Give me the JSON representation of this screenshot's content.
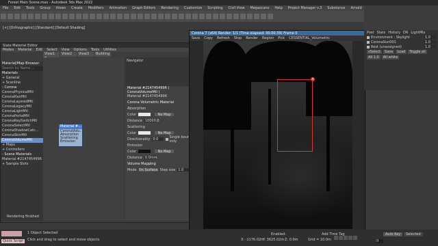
{
  "app": {
    "title": "Forest Main Scene.max - Autodesk 3ds Max 2022"
  },
  "menu": [
    "File",
    "Edit",
    "Tools",
    "Group",
    "Views",
    "Create",
    "Modifiers",
    "Animation",
    "Graph Editors",
    "Rendering",
    "Customize",
    "Scripting",
    "Civil View",
    "Megascans",
    "Help",
    "Project Manager v.3",
    "Substance",
    "Arnold",
    "Phoenix FD"
  ],
  "viewport_label": "[+] [Orthographic] [Standard] [Default Shading]",
  "material_editor": {
    "title": "Slate Material Editor",
    "menu": [
      "Modes",
      "Material",
      "Edit",
      "Select",
      "View",
      "Options",
      "Tools",
      "Utilities"
    ],
    "browser_title": "Material/Map Browser",
    "search_placeholder": "Search by Name ...",
    "tree": [
      {
        "label": "Materials",
        "kind": "header"
      },
      {
        "label": "+ General",
        "kind": "item"
      },
      {
        "label": "+ Scanline",
        "kind": "item"
      },
      {
        "label": "- Corona",
        "kind": "header"
      },
      {
        "label": "CoronaPhysicalMtl",
        "kind": "item"
      },
      {
        "label": "CoronaHairMtl",
        "kind": "item"
      },
      {
        "label": "CoronaLayeredMtl",
        "kind": "item"
      },
      {
        "label": "CoronaLegacyMtl",
        "kind": "item"
      },
      {
        "label": "CoronaLightMtl",
        "kind": "item"
      },
      {
        "label": "CoronaPortalMtl",
        "kind": "item"
      },
      {
        "label": "CoronaRaySwitchMtl",
        "kind": "item"
      },
      {
        "label": "CoronaSelectMtl",
        "kind": "item"
      },
      {
        "label": "CoronaShadowCatc...",
        "kind": "item"
      },
      {
        "label": "CoronaSkinMtl",
        "kind": "item"
      },
      {
        "label": "CoronaVolumeMtl",
        "kind": "selected"
      },
      {
        "label": "+ Maps",
        "kind": "item"
      },
      {
        "label": "+ Controllers",
        "kind": "item"
      },
      {
        "label": "- Scene Materials",
        "kind": "header"
      },
      {
        "label": "Material #2147454996",
        "kind": "item"
      },
      {
        "label": "+ Sample Slots",
        "kind": "item"
      }
    ],
    "view_tabs": [
      "View1",
      "View2",
      "View3",
      "Building",
      "Trees"
    ],
    "navigator_label": "Navigator",
    "node": {
      "title": "Material #...",
      "subtitle": "CoronaVolu...",
      "rows": [
        "Absorption",
        "Scattering",
        "Emission"
      ]
    },
    "params_title": "Material #2147454996 ( CoronaVolumeMtl )",
    "params_name": "Material #2147454996",
    "params": {
      "section": "Corona Volumetric Material",
      "absorption": "Absorption",
      "color_label": "Color",
      "no_map": "No Map",
      "distance_label": "Distance",
      "distance_value": "10000.0",
      "scattering": "Scattering",
      "directionality_label": "Directionality",
      "directionality_value": "0.0",
      "single_bounce": "Single bounce only",
      "emission": "Emission",
      "emission_distance": "0.0mm",
      "volume_mapping": "Volume Mapping",
      "mode_label": "Mode",
      "mode_value": "On Surface",
      "step_size_label": "Step size",
      "step_size_value": "1.0"
    }
  },
  "render": {
    "title": "Corona 7 (x64) Render: 1/1 (Time elapsed: 00:00:39) Frame 0",
    "toolbar": [
      "Save",
      "Copy",
      "Refresh",
      "Stop",
      "Render",
      "Region",
      "Pick",
      "CESSENTIAL_Volumetric"
    ],
    "side_tabs": [
      "Post",
      "Stats",
      "History",
      "DR",
      "LightMix"
    ],
    "layers": [
      {
        "label": "Environment : Skylight",
        "value": "1.0"
      },
      {
        "label": "CoronaSun001",
        "value": "1.0"
      },
      {
        "label": "Rest (unassigned)",
        "value": "1.0"
      }
    ],
    "buttons": [
      "sSelect",
      "Save",
      "Load",
      "Toggle all",
      "All 1.0",
      "All white"
    ]
  },
  "status": {
    "objects": "1 Object Selected",
    "hint": "Click and drag to select and move objects",
    "rendering": "Rendering finished",
    "x": "X: -1176.02m",
    "y": "Y: 3625.02m",
    "z": "Z: 0.0m",
    "grid": "Grid = 10.0m",
    "time_tag": "Add Time Tag",
    "enabled": "Enabled:",
    "frame": "0",
    "autokey": "Auto Key",
    "selected": "Selected",
    "maxscript": "Quick Script"
  },
  "colors": {
    "accent": "#4f7bc0",
    "render_title": "#3a6b9a",
    "region": "#dd3333"
  }
}
